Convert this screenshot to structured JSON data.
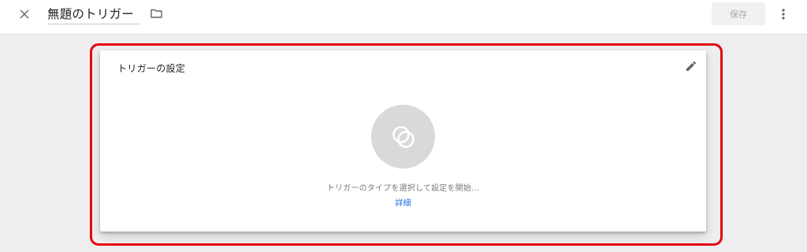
{
  "header": {
    "title": "無題のトリガー",
    "save_label": "保存",
    "icons": {
      "close": "close-icon",
      "folder": "folder-icon",
      "more": "more-vert-icon"
    }
  },
  "card": {
    "title": "トリガーの設定",
    "prompt": "トリガーのタイプを選択して設定を開始...",
    "details_link": "詳細",
    "icons": {
      "edit": "pencil-icon",
      "trigger": "trigger-type-icon"
    }
  },
  "colors": {
    "highlight": "#e60012",
    "link": "#1a73e8",
    "save_disabled_bg": "#f1f1f1"
  }
}
